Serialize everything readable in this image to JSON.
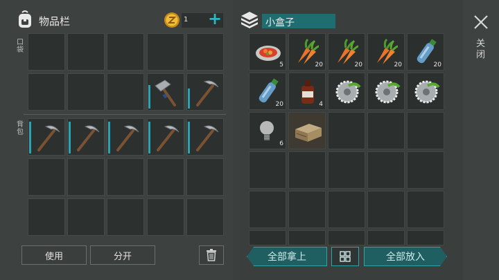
{
  "inventory": {
    "title": "物品栏",
    "coin_count": "1",
    "add_symbol": "+",
    "pocket_label": "口袋",
    "backpack_label": "背包",
    "slots": [
      {
        "item": "empty"
      },
      {
        "item": "empty"
      },
      {
        "item": "empty"
      },
      {
        "item": "empty"
      },
      {
        "item": "empty"
      },
      {
        "item": "empty"
      },
      {
        "item": "empty"
      },
      {
        "item": "empty"
      },
      {
        "item": "hammer-icon",
        "durability": 0.7
      },
      {
        "item": "pickaxe-icon",
        "durability": 0.6
      },
      {
        "item": "pickaxe-icon",
        "durability": 0.95
      },
      {
        "item": "pickaxe-icon",
        "durability": 0.95
      },
      {
        "item": "pickaxe-icon",
        "durability": 0.95
      },
      {
        "item": "pickaxe-icon",
        "durability": 0.95
      },
      {
        "item": "pickaxe-icon",
        "durability": 0.95
      },
      {
        "item": "empty"
      },
      {
        "item": "empty"
      },
      {
        "item": "empty"
      },
      {
        "item": "empty"
      },
      {
        "item": "empty"
      },
      {
        "item": "empty"
      },
      {
        "item": "empty"
      },
      {
        "item": "empty"
      },
      {
        "item": "empty"
      },
      {
        "item": "empty"
      }
    ],
    "use_button": "使用",
    "split_button": "分开",
    "trash_icon": "trash-icon"
  },
  "container": {
    "title": "小盒子",
    "items": [
      {
        "item": "salad-plate-icon",
        "count": "5"
      },
      {
        "item": "carrot-icon",
        "count": "20"
      },
      {
        "item": "carrot-icon",
        "count": "20"
      },
      {
        "item": "carrot-icon",
        "count": "20"
      },
      {
        "item": "water-bottle-icon",
        "count": "20"
      },
      {
        "item": "water-bottle-icon",
        "count": "20"
      },
      {
        "item": "brown-bottle-icon",
        "count": "4"
      },
      {
        "item": "saw-blade-icon",
        "count": ""
      },
      {
        "item": "saw-blade-icon",
        "count": ""
      },
      {
        "item": "saw-blade-icon",
        "count": ""
      },
      {
        "item": "light-bulb-icon",
        "count": "6"
      },
      {
        "item": "wooden-crate-icon",
        "count": ""
      },
      {
        "item": "empty",
        "count": ""
      },
      {
        "item": "empty",
        "count": ""
      },
      {
        "item": "empty",
        "count": ""
      },
      {
        "item": "empty",
        "count": ""
      },
      {
        "item": "empty",
        "count": ""
      },
      {
        "item": "empty",
        "count": ""
      },
      {
        "item": "empty",
        "count": ""
      },
      {
        "item": "empty",
        "count": ""
      },
      {
        "item": "empty",
        "count": ""
      },
      {
        "item": "empty",
        "count": ""
      },
      {
        "item": "empty",
        "count": ""
      },
      {
        "item": "empty",
        "count": ""
      },
      {
        "item": "empty",
        "count": ""
      },
      {
        "item": "empty",
        "count": ""
      },
      {
        "item": "empty",
        "count": ""
      },
      {
        "item": "empty",
        "count": ""
      },
      {
        "item": "empty",
        "count": ""
      },
      {
        "item": "empty",
        "count": ""
      }
    ],
    "take_all_button": "全部拿上",
    "put_all_button": "全部放入",
    "sort_icon": "grid-sort-icon"
  },
  "close": {
    "label": "关闭",
    "icon": "close-icon"
  },
  "colors": {
    "accent_teal": "#2fa5aa",
    "durability": "#2ba3b0",
    "coin": "#e0a92a"
  }
}
